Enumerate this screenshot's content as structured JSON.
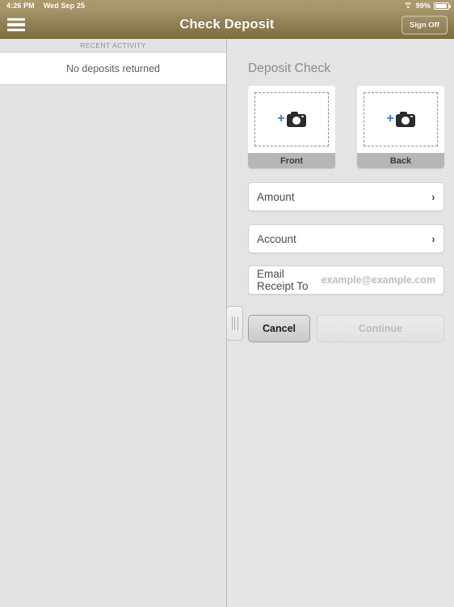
{
  "statusbar": {
    "time": "4:26 PM",
    "date": "Wed Sep 25",
    "battery_percent": "99%",
    "wifi_icon": "wifi-icon",
    "battery_icon": "battery-icon"
  },
  "navbar": {
    "menu_icon": "hamburger-menu-icon",
    "title": "Check Deposit",
    "signoff_label": "Sign Off"
  },
  "master": {
    "section_header": "RECENT ACTIVITY",
    "empty_message": "No deposits returned"
  },
  "detail": {
    "title": "Deposit Check",
    "captures": [
      {
        "label": "Front",
        "icon": "camera-icon",
        "plus": "+"
      },
      {
        "label": "Back",
        "icon": "camera-icon",
        "plus": "+"
      }
    ],
    "fields": [
      {
        "label": "Amount",
        "chevron": "›"
      },
      {
        "label": "Account",
        "chevron": "›"
      }
    ],
    "email": {
      "label": "Email Receipt To",
      "value": "",
      "placeholder": "example@example.com"
    },
    "buttons": {
      "cancel": "Cancel",
      "continue": "Continue"
    }
  },
  "colors": {
    "nav_gold_top": "#a3916a",
    "nav_gold_bottom": "#7e6f3d",
    "accent_blue": "#2a7fe0",
    "panel_gray": "#e4e4e4",
    "label_bar_gray": "#b6b6b6"
  }
}
